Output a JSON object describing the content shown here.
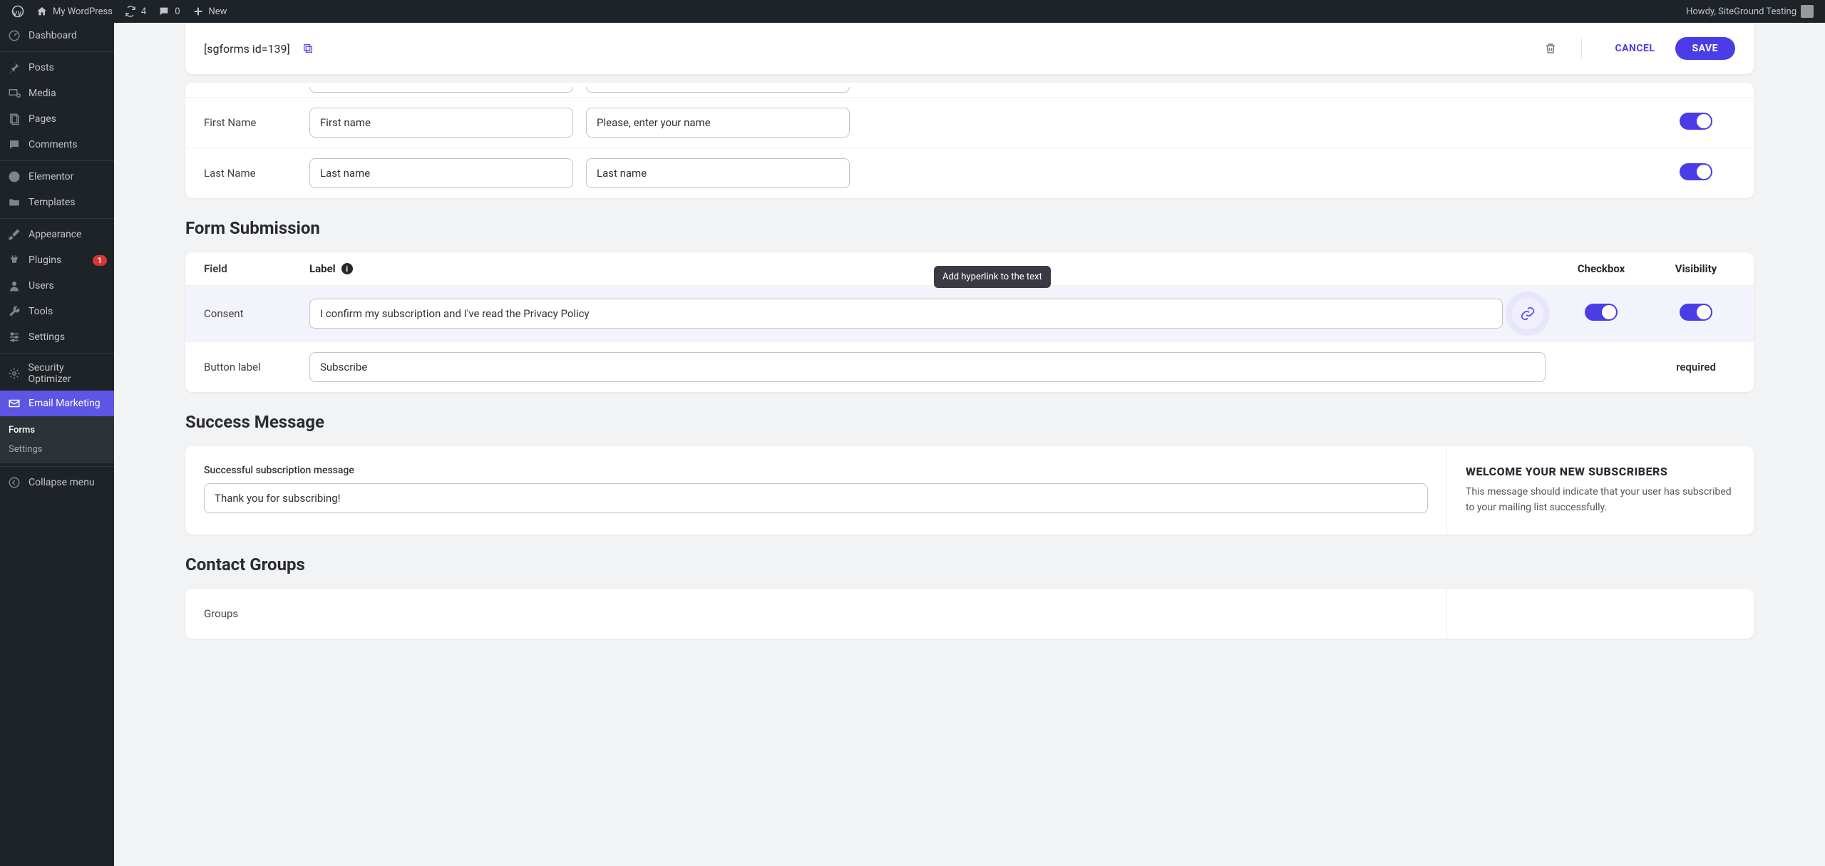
{
  "admin_bar": {
    "site_name": "My WordPress",
    "updates": "4",
    "comments": "0",
    "new_label": "New",
    "howdy": "Howdy, SiteGround Testing"
  },
  "sidebar": {
    "items": [
      {
        "label": "Dashboard"
      },
      {
        "label": "Posts"
      },
      {
        "label": "Media"
      },
      {
        "label": "Pages"
      },
      {
        "label": "Comments"
      },
      {
        "label": "Elementor"
      },
      {
        "label": "Templates"
      },
      {
        "label": "Appearance"
      },
      {
        "label": "Plugins",
        "badge": "1"
      },
      {
        "label": "Users"
      },
      {
        "label": "Tools"
      },
      {
        "label": "Settings"
      },
      {
        "label": "Security Optimizer"
      },
      {
        "label": "Email Marketing",
        "current": true
      }
    ],
    "submenu": [
      {
        "label": "Forms",
        "current": true
      },
      {
        "label": "Settings"
      }
    ],
    "collapse": "Collapse menu"
  },
  "header": {
    "shortcode": "[sgforms id=139]",
    "cancel": "CANCEL",
    "save": "SAVE"
  },
  "field_rows": [
    {
      "field": "First Name",
      "label_value": "First name",
      "placeholder_value": "Please, enter your name"
    },
    {
      "field": "Last Name",
      "label_value": "Last name",
      "placeholder_value": "Last name"
    }
  ],
  "submission": {
    "title": "Form Submission",
    "columns": {
      "field": "Field",
      "label": "Label",
      "checkbox": "Checkbox",
      "visibility": "Visibility"
    },
    "consent_field": "Consent",
    "consent_value": "I confirm my subscription and I've read the Privacy Policy",
    "button_field": "Button label",
    "button_value": "Subscribe",
    "required": "required"
  },
  "tooltip": "Add hyperlink to the text",
  "success": {
    "title": "Success Message",
    "label": "Successful subscription message",
    "value": "Thank you for subscribing!",
    "welcome_heading": "WELCOME YOUR NEW SUBSCRIBERS",
    "welcome_text": "This message should indicate that your user has subscribed to your mailing list successfully."
  },
  "contact_groups": {
    "title": "Contact Groups",
    "groups_label": "Groups"
  }
}
